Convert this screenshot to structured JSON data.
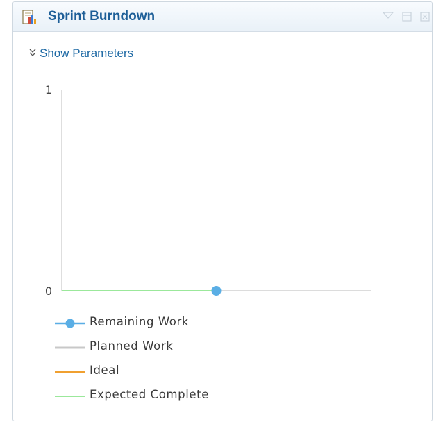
{
  "widget": {
    "title": "Sprint Burndown",
    "title_icon": "report-chart-icon",
    "controls": [
      "filter-icon",
      "maximize-icon",
      "close-icon"
    ],
    "show_parameters_label": "Show Parameters"
  },
  "colors": {
    "title": "#1e5f98",
    "link": "#1f6aa5",
    "remaining_work": "#5aaee5",
    "planned_work": "#c8c8c8",
    "ideal": "#f0a030",
    "expected_complete": "#9be89b",
    "axis": "#c8c8c8"
  },
  "chart_data": {
    "type": "line",
    "ylim": [
      0,
      1
    ],
    "ytick_labels": [
      "0",
      "1"
    ],
    "grid": false,
    "legend_position": "bottom",
    "series": [
      {
        "name": "Remaining Work",
        "marker": "circle",
        "points": [
          [
            0,
            0
          ],
          [
            1,
            0
          ]
        ]
      },
      {
        "name": "Planned Work",
        "points": []
      },
      {
        "name": "Ideal",
        "points": []
      },
      {
        "name": "Expected Complete",
        "points": [
          [
            0,
            0
          ],
          [
            1,
            0
          ]
        ]
      }
    ],
    "x_domain": [
      0,
      2
    ]
  }
}
